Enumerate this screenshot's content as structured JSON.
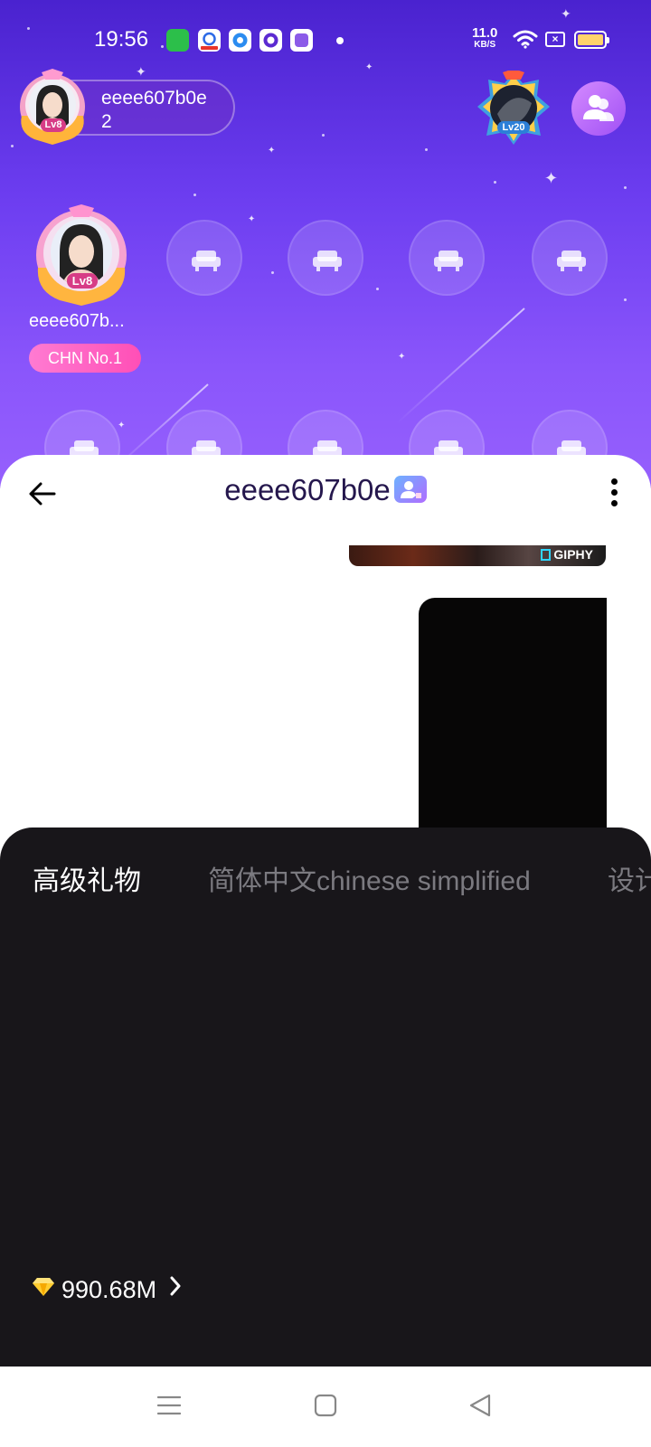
{
  "status_bar": {
    "time": "19:56",
    "net_speed_value": "11.0",
    "net_speed_unit": "KB/S",
    "battery_color": "#ffd36b"
  },
  "room": {
    "host": {
      "name": "eeee607b0e\n2",
      "level": "Lv8"
    },
    "right_badge_level": "Lv20",
    "seat_user": {
      "name": "eeee607b...",
      "level": "Lv8",
      "tag": "CHN No.1"
    },
    "colors": {
      "bg_top": "#4a22cf",
      "bg_bottom": "#9660fd",
      "tag_pink": "#ff4fb6"
    }
  },
  "chat": {
    "title": "eeee607b0e",
    "gif_label": "GIPHY"
  },
  "gift_panel": {
    "tabs": [
      {
        "label": "高级礼物",
        "active": true
      },
      {
        "label": "简体中文chinese simplified",
        "active": false
      },
      {
        "label": "设计",
        "active": false
      }
    ],
    "balance": "990.68M"
  },
  "icons": {
    "back": "back-arrow-icon",
    "more": "more-vertical-icon",
    "gem": "diamond-icon",
    "seat": "sofa-icon",
    "invite": "users-icon",
    "nav": [
      "menu-icon",
      "home-square-icon",
      "back-triangle-icon"
    ]
  }
}
